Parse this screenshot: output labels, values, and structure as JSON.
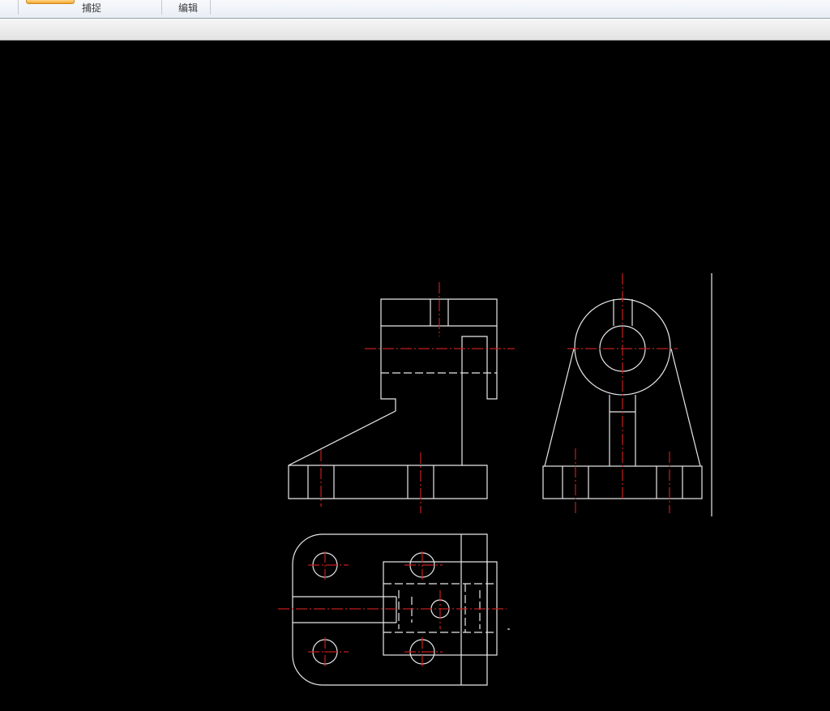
{
  "ribbon": {
    "panel_capture": "捕捉",
    "panel_edit": "编辑"
  },
  "colors": {
    "canvas_bg": "#000000",
    "geometry": "#e8e8e8",
    "centerline": "#c41e1e"
  }
}
